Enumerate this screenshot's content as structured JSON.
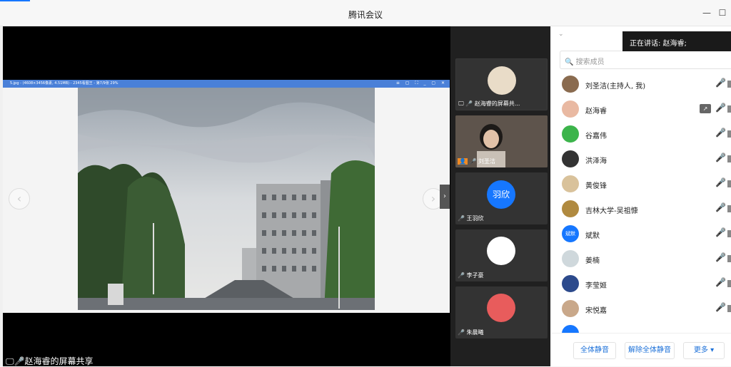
{
  "window": {
    "title": "腾讯会议",
    "minimize_glyph": "—",
    "maximize_glyph": "☐"
  },
  "share": {
    "file_title": "5.jpg - (4608×3456像素, 4.51MB) - 2345看图王 - 第7/9张 29%",
    "window_controls": "≡ ▢ ⛶ _ ▢ ✕",
    "label": "赵海睿的屏幕共享",
    "prev_glyph": "‹",
    "next_glyph": "›",
    "collapse_glyph": "›"
  },
  "speaking_banner": "正在讲话: 赵海睿;",
  "video_tiles": [
    {
      "name": "赵海睿的屏幕共...",
      "avatar_color": "#e9dcc8"
    },
    {
      "name": "刘圣洁"
    },
    {
      "name": "王羽欣",
      "avatar_text": "羽欣",
      "avatar_color": "#1677ff"
    },
    {
      "name": "李子豪",
      "avatar_color": "#ffffff"
    },
    {
      "name": "朱晨曦",
      "avatar_color": "#e85c5c"
    }
  ],
  "panel": {
    "search_placeholder": "搜索成员",
    "members": [
      {
        "name": "刘圣洁(主持人, 我)",
        "avatar_color": "#8a6b4f",
        "mic": "idle"
      },
      {
        "name": "赵海睿",
        "avatar_color": "#e9b9a2",
        "mic": "live",
        "sharing": true
      },
      {
        "name": "谷嘉伟",
        "avatar_color": "#3cb44b",
        "mic": "muted"
      },
      {
        "name": "洪泽海",
        "avatar_color": "#333333",
        "mic": "muted"
      },
      {
        "name": "黄俊锋",
        "avatar_color": "#d9c29b",
        "mic": "muted"
      },
      {
        "name": "吉林大学-吴祖慷",
        "avatar_color": "#b08a40",
        "mic": "muted"
      },
      {
        "name": "斌默",
        "avatar_text": "斌默",
        "avatar_color": "#1677ff",
        "mic": "muted"
      },
      {
        "name": "姜楠",
        "avatar_color": "#cfd8dc",
        "mic": "muted"
      },
      {
        "name": "李莹姬",
        "avatar_color": "#2c4a8c",
        "mic": "muted"
      },
      {
        "name": "宋悦嘉",
        "avatar_color": "#c9a88a",
        "mic": "muted"
      }
    ],
    "footer": {
      "mute_all": "全体静音",
      "unmute_all": "解除全体静音",
      "more": "更多 ▾"
    }
  },
  "icons": {
    "mic": "microphone-icon",
    "mic_muted": "microphone-muted-icon",
    "screen": "screen-share-icon"
  }
}
